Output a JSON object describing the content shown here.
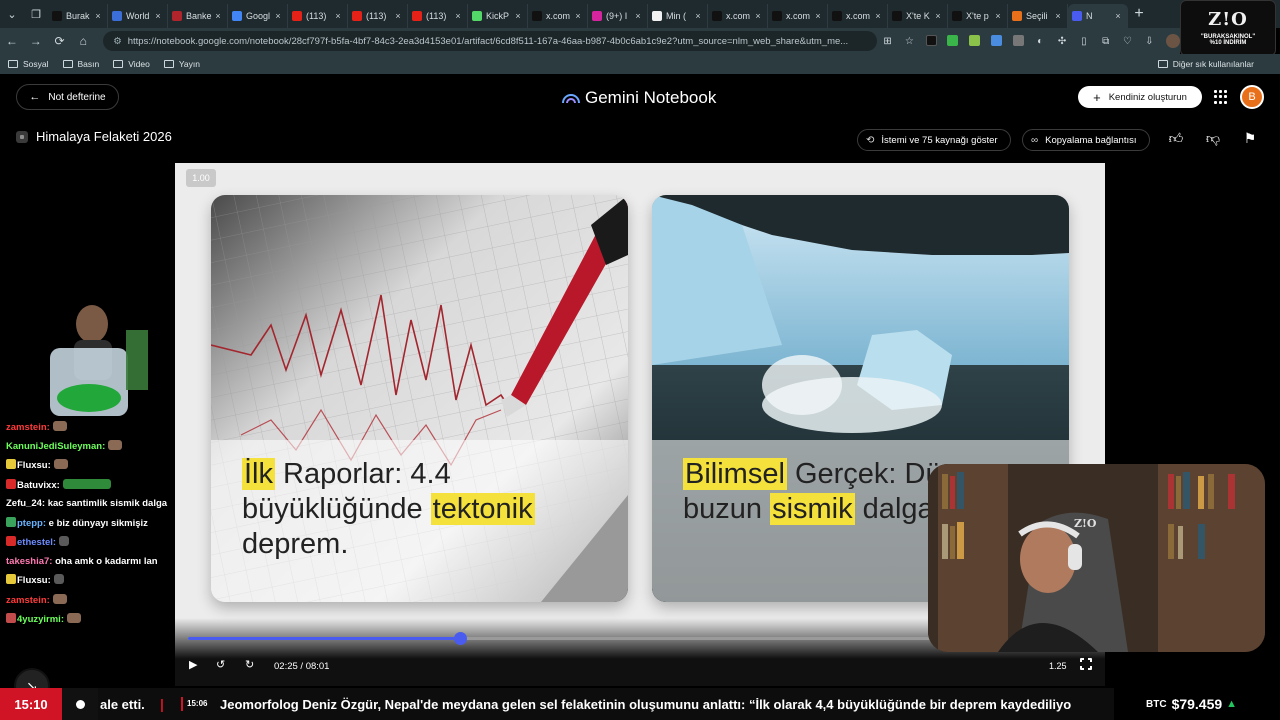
{
  "browser": {
    "tabs": [
      {
        "title": "Burak",
        "color": "#111111"
      },
      {
        "title": "World",
        "color": "#3b6ed6"
      },
      {
        "title": "Banke",
        "color": "#b0242b"
      },
      {
        "title": "Googl",
        "color": "#4285f4"
      },
      {
        "title": "(113) ",
        "color": "#e62117"
      },
      {
        "title": "(113) ",
        "color": "#e62117"
      },
      {
        "title": "(113) ",
        "color": "#e62117"
      },
      {
        "title": "KickP",
        "color": "#53d769"
      },
      {
        "title": "x.com",
        "color": "#111111"
      },
      {
        "title": "(9+) I",
        "color": "#d6249f"
      },
      {
        "title": "Min (",
        "color": "#f1f1f1"
      },
      {
        "title": "x.com",
        "color": "#111111"
      },
      {
        "title": "x.com",
        "color": "#111111"
      },
      {
        "title": "x.com",
        "color": "#111111"
      },
      {
        "title": "X'te K",
        "color": "#111111"
      },
      {
        "title": "X'te p",
        "color": "#111111"
      },
      {
        "title": "Seçili",
        "color": "#e8701a"
      },
      {
        "title": "N",
        "color": "#4a5cf0"
      }
    ],
    "url": "https://notebook.google.com/notebook/28cf797f-b5fa-4bf7-84c3-2ea3d4153e01/artifact/6cd8f511-167a-46aa-b987-4b0c6ab1c9e2?utm_source=nlm_web_share&utm_me...",
    "bookmarks": [
      "Sosyal",
      "Basın",
      "Video",
      "Yayın"
    ],
    "other_bookmarks": "Diğer sık kullanılanlar",
    "sponsor": {
      "logo": "Z!O",
      "line1": "\"BURAKSAKINOL\"",
      "line2": "%10 İNDİRİM"
    }
  },
  "app": {
    "back_label": "Not defterine",
    "brand": "Gemini Notebook",
    "create_label": "Kendiniz oluşturun",
    "user_initial": "B",
    "notebook_title": "Himalaya Felaketi 2026",
    "show_sources_label": "İstemi ve 75 kaynağı göster",
    "copy_link_label": "Kopyalama bağlantısı"
  },
  "player": {
    "speed_badge": "1.00",
    "left_card": {
      "pre": "",
      "hl1": "İlk",
      "mid1": " Raporlar: 4.4",
      "line2_pre": "büyüklüğünde ",
      "hl2": "tektonik",
      "line3": "deprem."
    },
    "right_card": {
      "hl1": "Bilimsel",
      "mid1": " Gerçek: Düş",
      "line2_pre": "buzun ",
      "hl2": "sismik",
      "line2_post": " dalga"
    },
    "progress": 0.3,
    "time_label": "02:25 / 08:01",
    "rate_label": "1.25"
  },
  "chat": [
    {
      "user": "zamstein:",
      "color": "#ff3b3b",
      "text": "",
      "emote": "brown"
    },
    {
      "user": "KanuniJediSuleyman:",
      "color": "#6cff5c",
      "text": "",
      "emote": "brown"
    },
    {
      "user": "Fluxsu:",
      "color": "#ffffff",
      "badge": "#e6c93a",
      "text": "",
      "emote": "brown"
    },
    {
      "user": "Batuvixx:",
      "color": "#ffffff",
      "badge": "#d92a2a",
      "text": "",
      "emote": "green"
    },
    {
      "user": "Zefu_24:",
      "color": "#ffffff",
      "text": "kac santimlik sismik dalga",
      "wrap": true
    },
    {
      "user": "ptepp:",
      "color": "#66b3ff",
      "badge": "#3aa35b",
      "text": "e biz dünyayı sikmişiz"
    },
    {
      "user": "ethestel:",
      "color": "#6c8cff",
      "badge": "#d92a2a",
      "text": "",
      "emote": "gray"
    },
    {
      "user": "takeshia7:",
      "color": "#ff7ab3",
      "text": "oha amk o kadarmı lan"
    },
    {
      "user": "Fluxsu:",
      "color": "#ffffff",
      "badge": "#e6c93a",
      "text": "",
      "emote": "gray"
    },
    {
      "user": "zamstein:",
      "color": "#ff3b3b",
      "text": "",
      "emote": "brown"
    },
    {
      "user": "4yuzyirmi:",
      "color": "#6cff5c",
      "badge": "#c24b4b",
      "text": "",
      "emote": "brown"
    }
  ],
  "webcam_logo": "Z!O",
  "ticker": {
    "time": "15:10",
    "prev": "ale etti.",
    "small_time": "15:06",
    "text": "Jeomorfolog Deniz Özgür, Nepal'de meydana gelen sel felaketinin oluşumunu anlattı: “İlk olarak 4,4 büyüklüğünde bir deprem kaydediliyo",
    "btc_label": "BTC",
    "btc_value": "$79.459",
    "btc_arrow": "▲"
  }
}
